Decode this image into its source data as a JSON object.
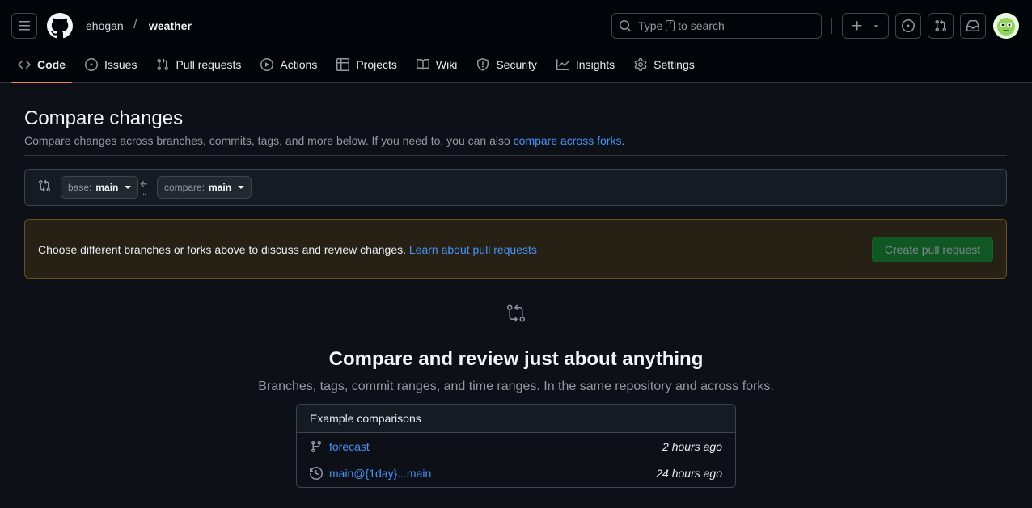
{
  "header": {
    "owner": "ehogan",
    "separator": "/",
    "repo": "weather",
    "search": {
      "prefix": "Type",
      "key": "/",
      "suffix": "to search"
    }
  },
  "nav": {
    "items": [
      {
        "label": "Code",
        "icon": "code-icon",
        "active": true
      },
      {
        "label": "Issues",
        "icon": "issue-icon"
      },
      {
        "label": "Pull requests",
        "icon": "git-pull-request-icon"
      },
      {
        "label": "Actions",
        "icon": "play-icon"
      },
      {
        "label": "Projects",
        "icon": "table-icon"
      },
      {
        "label": "Wiki",
        "icon": "book-icon"
      },
      {
        "label": "Security",
        "icon": "shield-icon"
      },
      {
        "label": "Insights",
        "icon": "graph-icon"
      },
      {
        "label": "Settings",
        "icon": "gear-icon"
      }
    ]
  },
  "page": {
    "title": "Compare changes",
    "subtitle": "Compare changes across branches, commits, tags, and more below. If you need to, you can also",
    "subtitle_link": "compare across forks",
    "subtitle_end": "."
  },
  "range": {
    "base_label": "base:",
    "base_value": "main",
    "compare_label": "compare:",
    "compare_value": "main",
    "dots": "..."
  },
  "flash": {
    "text": "Choose different branches or forks above to discuss and review changes.",
    "link": "Learn about pull requests",
    "button": "Create pull request"
  },
  "blankslate": {
    "title": "Compare and review just about anything",
    "description": "Branches, tags, commit ranges, and time ranges. In the same repository and across forks."
  },
  "examples": {
    "header": "Example comparisons",
    "rows": [
      {
        "icon": "git-branch-icon",
        "label": "forecast",
        "time": "2 hours ago"
      },
      {
        "icon": "history-icon",
        "label": "main@{1day}...main",
        "time": "24 hours ago"
      }
    ]
  },
  "colors": {
    "background": "#0d1117",
    "header_bg": "#010409",
    "link": "#4493f8",
    "active_tab": "#f78166",
    "flash_bg": "#272115",
    "flash_border": "#6c5116",
    "button_green": "#105823"
  }
}
